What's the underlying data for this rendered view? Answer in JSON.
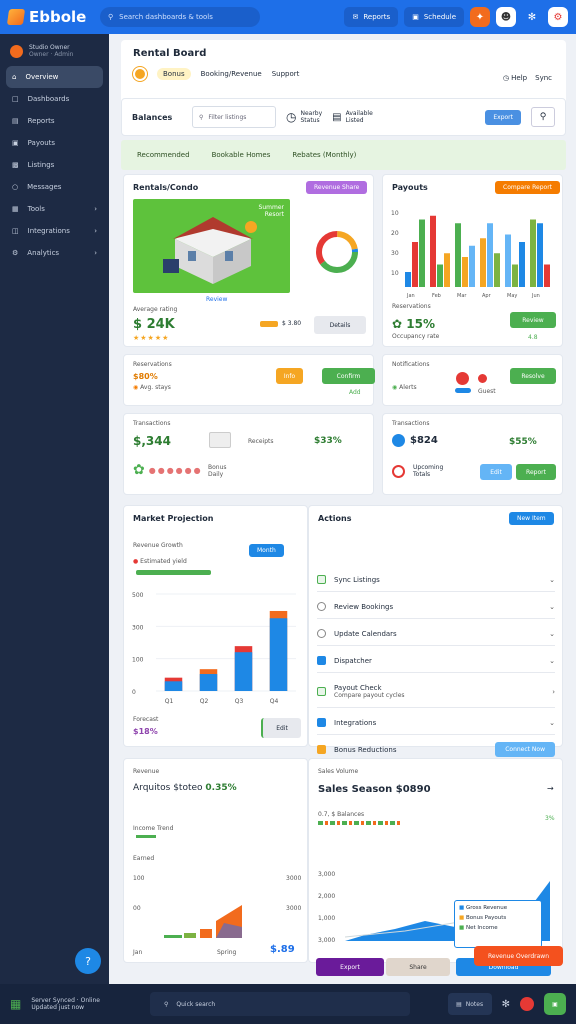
{
  "app": {
    "name": "Ebbole",
    "search_placeholder": "Search dashboards & tools",
    "top_btn1": "Reports",
    "top_btn2": "Schedule"
  },
  "sidebar": {
    "user_name": "Studio Owner",
    "user_sub": "Owner · Admin",
    "items": [
      {
        "label": "Overview",
        "icon": "home-icon",
        "active": true,
        "chevron": false
      },
      {
        "label": "Dashboards",
        "icon": "panel-icon",
        "chevron": false
      },
      {
        "label": "Reports",
        "icon": "doc-icon",
        "chevron": false
      },
      {
        "label": "Payouts",
        "icon": "wallet-icon",
        "chevron": false
      },
      {
        "label": "Listings",
        "icon": "building-icon",
        "chevron": false
      },
      {
        "label": "Messages",
        "icon": "chat-icon",
        "chevron": false
      },
      {
        "label": "Tools",
        "icon": "grid-icon",
        "chevron": true
      },
      {
        "label": "Integrations",
        "icon": "plug-icon",
        "chevron": true
      },
      {
        "label": "Analytics",
        "icon": "gear-icon",
        "chevron": true
      }
    ]
  },
  "header": {
    "title": "Rental Board",
    "coin_label": "Bonus",
    "tab1": "Booking/Revenue",
    "tab2": "Support",
    "link1": "Help",
    "link2": "Sync"
  },
  "filter": {
    "title": "Balances",
    "search": "Filter listings",
    "item1_top": "Nearby",
    "item1_bot": "Status",
    "item2_top": "Available",
    "item2_bot": "Listed",
    "button": "Export"
  },
  "chips": [
    "Recommended",
    "Bookable Homes",
    "Rebates (Monthly)"
  ],
  "card_property": {
    "title": "Rentals/Condo",
    "tag": "Revenue Share",
    "tag_color": "#b06de0",
    "img_label1": "Summer",
    "img_label2": "Resort",
    "img_caption": "Review",
    "rating_label": "Average rating",
    "value": "$ 24K",
    "rate": "$ 3.80",
    "btn": "Details"
  },
  "card_bars": {
    "title": "Payouts",
    "tag": "Compare Report",
    "tag_color": "#f57c00",
    "y_ticks": [
      "10",
      "20",
      "30",
      "10"
    ],
    "x_ticks": [
      "Jan",
      "Feb",
      "Mar",
      "Apr",
      "May",
      "Jun"
    ],
    "sub_label": "Reservations",
    "value": "15%",
    "sub2": "Occupancy rate",
    "btn": "Review",
    "small": "4.8"
  },
  "card3": {
    "label": "Reservations",
    "value": "$80%",
    "sub": "Avg. stays",
    "btn_orange": "Info",
    "btn_green": "Confirm",
    "tiny": "Add"
  },
  "card4": {
    "label": "Notifications",
    "sub": "Alerts",
    "btn": "Resolve",
    "tiny": "Guest"
  },
  "card5": {
    "label": "Transactions",
    "value": "$,344",
    "img_label": "Receipts",
    "val2": "$33%",
    "small1": "Bonus",
    "small2": "Daily"
  },
  "card6": {
    "label": "Transactions",
    "value": "$824",
    "val2": "$55%",
    "note_top": "Upcoming",
    "note_bot": "Totals",
    "btn1": "Edit",
    "btn2": "Report"
  },
  "market": {
    "title": "Market Projection",
    "dropdown": "Month",
    "legend": "Revenue Growth",
    "sub": "Estimated yield",
    "y_ticks": [
      "500",
      "300",
      "100",
      "0"
    ],
    "x_ticks": [
      "Q1",
      "Q2",
      "Q3",
      "Q4"
    ],
    "foot_label": "Forecast",
    "foot_value": "$18%",
    "btn": "Edit"
  },
  "chart_data": {
    "type": "bar",
    "categories": [
      "Q1",
      "Q2",
      "Q3",
      "Q4"
    ],
    "series": [
      {
        "values": [
          40,
          70,
          160,
          300
        ]
      },
      {
        "values": [
          55,
          90,
          185,
          330
        ]
      }
    ],
    "ylim": [
      0,
      400
    ],
    "y_ticks": [
      "500",
      "300",
      "100",
      "0"
    ],
    "xlabel": "",
    "ylabel": ""
  },
  "actions": {
    "title": "Actions",
    "btn": "New Item",
    "rows": [
      {
        "label": "Sync Listings",
        "icon": "check-box",
        "chevron": "v"
      },
      {
        "label": "Review Bookings",
        "icon": "radio",
        "chevron": "v"
      },
      {
        "label": "Update Calendars",
        "icon": "radio",
        "chevron": "v"
      },
      {
        "label": "Dispatcher",
        "icon": "blue-box",
        "chevron": "v"
      },
      {
        "label": "Payout Check",
        "sub": "Compare payout cycles",
        "icon": "check-box",
        "chevron": ">"
      },
      {
        "label": "Integrations",
        "icon": "blue-box",
        "chevron": "v"
      },
      {
        "label": "Bonus Reductions",
        "icon": "alert-box",
        "chevron": "",
        "button": "Connect Now"
      }
    ]
  },
  "revenue": {
    "title": "Revenue",
    "value": "Arquitos $toteo",
    "pct": "0.35%",
    "sub": "Income Trend",
    "axis_label": "Earned",
    "y1": "100",
    "y2": "00",
    "r1": "3000",
    "r2": "3000",
    "foot1": "Jan",
    "foot2": "Spring",
    "foot_value": "$.89"
  },
  "sales": {
    "title": "Sales Volume",
    "value": "Sales Season $0890",
    "sub": "0.7, $ Balances",
    "pct": "3%",
    "y_ticks": [
      "3,000",
      "2,000",
      "1,000",
      "3,000"
    ],
    "legend": [
      "Gross Revenue",
      "Bonus Payouts",
      "Net Income"
    ],
    "btns": [
      "Export",
      "Share",
      "Download"
    ],
    "alert": "Revenue Overdrawn"
  },
  "bottom": {
    "status1": "Server Synced · Online",
    "status2": "Updated just now",
    "search": "Quick search",
    "btn": "Notes"
  }
}
